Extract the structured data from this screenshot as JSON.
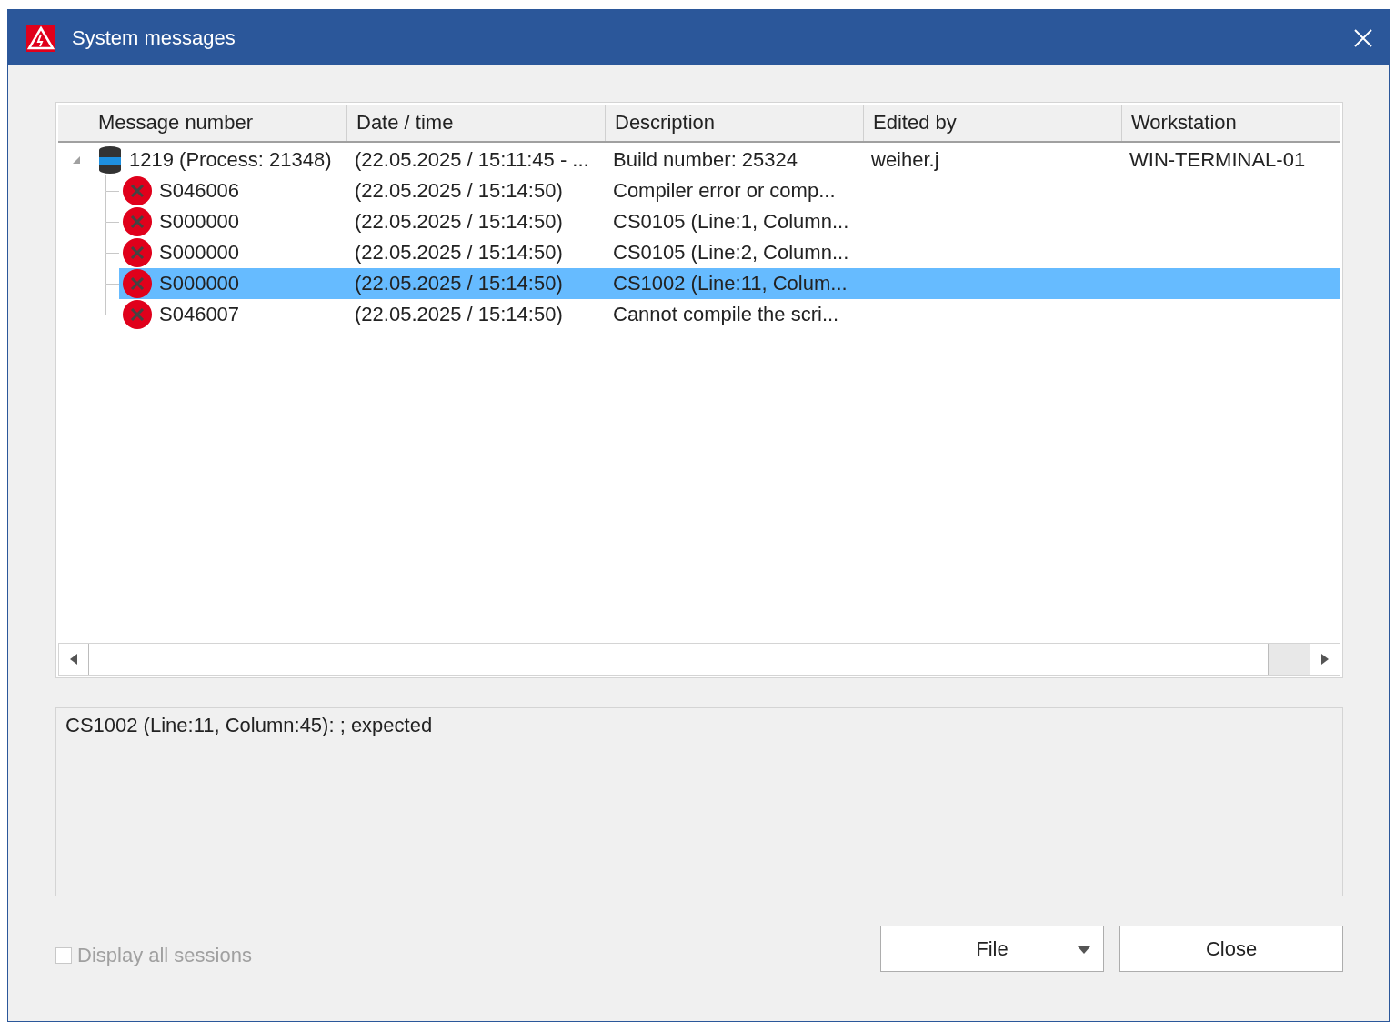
{
  "window": {
    "title": "System messages"
  },
  "table": {
    "columns": [
      "Message number",
      "Date / time",
      "Description",
      "Edited by",
      "Workstation"
    ],
    "rows": [
      {
        "kind": "process",
        "message_number": "1219 (Process: 21348)",
        "date_time": "(22.05.2025 / 15:11:45 -  ...",
        "description": "Build number: 25324",
        "edited_by": "weiher.j",
        "workstation": "WIN-TERMINAL-01",
        "expanded": true,
        "selected": false,
        "children": [
          {
            "kind": "error",
            "message_number": "S046006",
            "date_time": "(22.05.2025 / 15:14:50)",
            "description": "Compiler error or comp...",
            "selected": false
          },
          {
            "kind": "error",
            "message_number": "S000000",
            "date_time": "(22.05.2025 / 15:14:50)",
            "description": "CS0105 (Line:1, Column...",
            "selected": false
          },
          {
            "kind": "error",
            "message_number": "S000000",
            "date_time": "(22.05.2025 / 15:14:50)",
            "description": "CS0105 (Line:2, Column...",
            "selected": false
          },
          {
            "kind": "error",
            "message_number": "S000000",
            "date_time": "(22.05.2025 / 15:14:50)",
            "description": "CS1002 (Line:11, Colum...",
            "selected": true
          },
          {
            "kind": "error",
            "message_number": "S046007",
            "date_time": "(22.05.2025 / 15:14:50)",
            "description": "Cannot compile the scri...",
            "selected": false
          }
        ]
      }
    ]
  },
  "detail": {
    "text": "CS1002 (Line:11, Column:45): ; expected"
  },
  "option": {
    "label": "Display all sessions",
    "checked": false,
    "disabled": true
  },
  "buttons": [
    {
      "label": "File",
      "kind": "dropdown"
    },
    {
      "label": "Close",
      "kind": "plain"
    }
  ]
}
